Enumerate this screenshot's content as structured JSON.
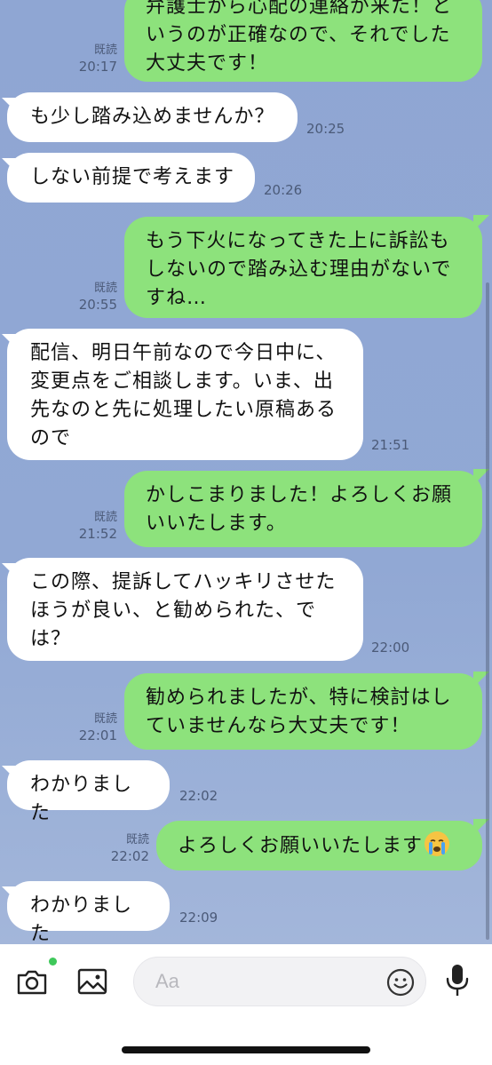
{
  "messages": [
    {
      "side": "out",
      "lines": [
        "弁護士から心配の連絡が来た！と",
        "いうのが正確なので、それでした",
        "大丈夫です！"
      ],
      "read": "既読",
      "time": "20:17"
    },
    {
      "side": "in",
      "lines": [
        "も少し踏み込めませんか？"
      ],
      "time": "20:25"
    },
    {
      "side": "in",
      "lines": [
        "しない前提で考えます"
      ],
      "time": "20:26"
    },
    {
      "side": "out",
      "lines": [
        "もう下火になってきた上に訴訟も",
        "しないので踏み込む理由がないで",
        "すね…"
      ],
      "read": "既読",
      "time": "20:55"
    },
    {
      "side": "in",
      "lines": [
        "配信、明日午前なので今日中に、",
        "変更点をご相談します。いま、出",
        "先なのと先に処理したい原稿ある",
        "ので"
      ],
      "time": "21:51"
    },
    {
      "side": "out",
      "lines": [
        "かしこまりました！よろしくお願",
        "いいたします。"
      ],
      "read": "既読",
      "time": "21:52"
    },
    {
      "side": "in",
      "lines": [
        "この際、提訴してハッキリさせた",
        "ほうが良い、と勧められた、で",
        "は？"
      ],
      "time": "22:00"
    },
    {
      "side": "out",
      "lines": [
        "勧められましたが、特に検討はし",
        "ていませんなら大丈夫です！"
      ],
      "read": "既読",
      "time": "22:01"
    },
    {
      "side": "in",
      "lines": [
        "わかりました"
      ],
      "time": "22:02"
    },
    {
      "side": "out",
      "lines": [
        "よろしくお願いいたします"
      ],
      "emoji": "crying-face",
      "read": "既読",
      "time": "22:02"
    },
    {
      "side": "in",
      "lines": [
        "わかりました"
      ],
      "time": "22:09"
    }
  ],
  "input": {
    "placeholder": "Aa"
  },
  "icons": {
    "camera": "camera-icon",
    "image": "image-icon",
    "emoji": "smiley-icon",
    "mic": "microphone-icon"
  },
  "colors": {
    "background": "#91a8d4",
    "outgoing_bubble": "#8de27c",
    "incoming_bubble": "#ffffff",
    "notification_dot": "#3ec85a"
  }
}
